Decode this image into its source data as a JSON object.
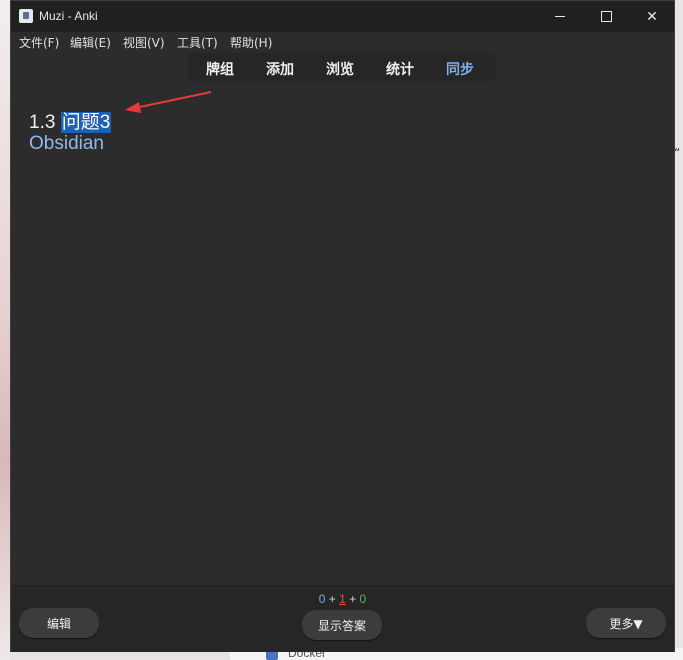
{
  "window": {
    "title": "Muzi - Anki",
    "controls": {
      "minimize": "minimize",
      "maximize": "maximize",
      "close": "✕"
    }
  },
  "menu": [
    "文件(F)",
    "编辑(E)",
    "视图(V)",
    "工具(T)",
    "帮助(H)"
  ],
  "toolbar": [
    "牌组",
    "添加",
    "浏览",
    "统计",
    "同步"
  ],
  "card": {
    "line1_prefix": "1.3 ",
    "line1_highlight": "问题3",
    "line2": "Obsidian"
  },
  "counts": {
    "new": "0",
    "learn": "1",
    "review": "0",
    "plus": "+"
  },
  "buttons": {
    "edit": "编辑",
    "show_answer": "显示答案",
    "more": "更多▼"
  },
  "desktop": {
    "taskbar_item": "Docker"
  },
  "colors": {
    "window_bg": "#2c2c2c",
    "titlebar_bg": "#202020",
    "sync_accent": "#7fb0ee",
    "highlight": "#1f5fb6",
    "arrow": "#e23b3b"
  }
}
